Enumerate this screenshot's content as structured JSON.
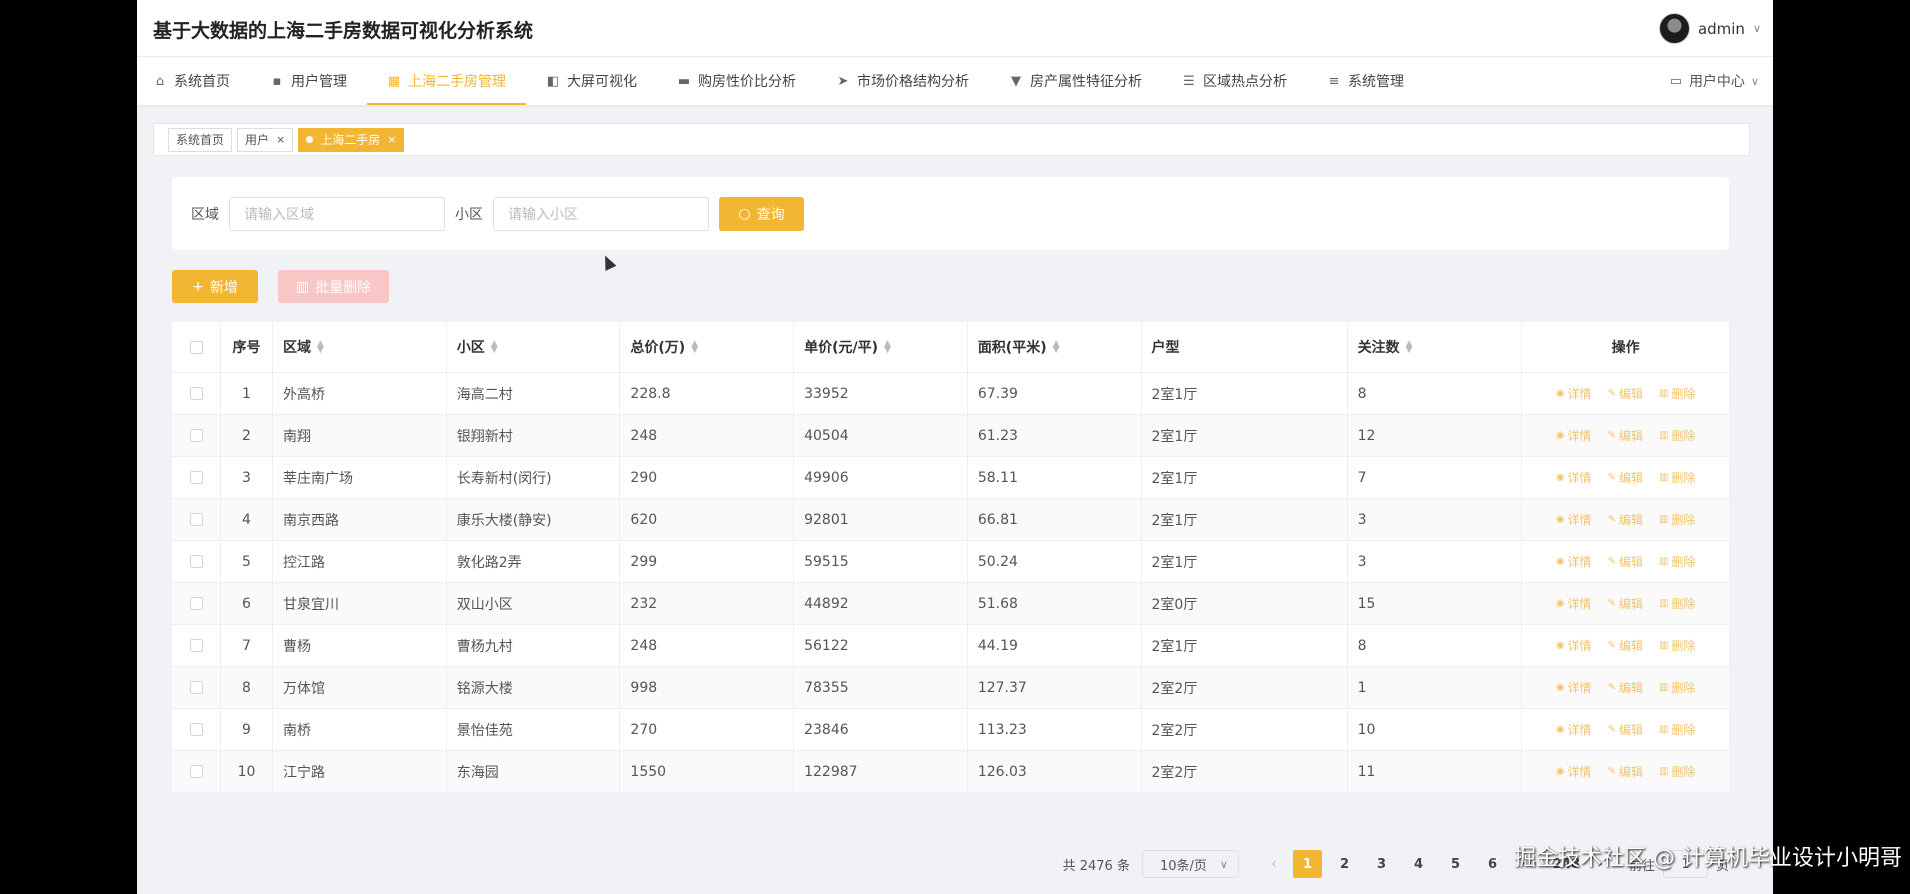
{
  "app": {
    "title": "基于大数据的上海二手房数据可视化分析系统",
    "username": "admin"
  },
  "menu": [
    {
      "label": "系统首页",
      "icon": "home-icon",
      "glyph": "⌂"
    },
    {
      "label": "用户管理",
      "icon": "chat-icon",
      "glyph": "▪"
    },
    {
      "label": "上海二手房管理",
      "icon": "grid-icon",
      "glyph": "▦"
    },
    {
      "label": "大屏可视化",
      "icon": "wallet-icon",
      "glyph": "◧"
    },
    {
      "label": "购房性价比分析",
      "icon": "briefcase-icon",
      "glyph": "▬"
    },
    {
      "label": "市场价格结构分析",
      "icon": "send-icon",
      "glyph": "➤"
    },
    {
      "label": "房产属性特征分析",
      "icon": "ice-cream-icon",
      "glyph": "▼"
    },
    {
      "label": "区域热点分析",
      "icon": "sliders-icon",
      "glyph": "☰"
    },
    {
      "label": "系统管理",
      "icon": "list-icon",
      "glyph": "≡"
    }
  ],
  "active_menu": "上海二手房管理",
  "user_center": "用户中心",
  "tags": [
    {
      "label": "系统首页"
    },
    {
      "label": "用户",
      "close": "×"
    },
    {
      "label": "上海二手房",
      "close": "×"
    }
  ],
  "search": {
    "region_label": "区域",
    "region_placeholder": "请输入区域",
    "community_label": "小区",
    "community_placeholder": "请输入小区",
    "query_button": "查询"
  },
  "actions": {
    "add": "新增",
    "batch_delete": "批量删除"
  },
  "table": {
    "headers": [
      "序号",
      "区域",
      "小区",
      "总价(万)",
      "单价(元/平)",
      "面积(平米)",
      "户型",
      "关注数",
      "操作"
    ],
    "row_actions": {
      "detail": "详情",
      "edit": "编辑",
      "delete": "删除"
    },
    "rows": [
      [
        "1",
        "外高桥",
        "海高二村",
        "228.8",
        "33952",
        "67.39",
        "2室1厅",
        "8"
      ],
      [
        "2",
        "南翔",
        "银翔新村",
        "248",
        "40504",
        "61.23",
        "2室1厅",
        "12"
      ],
      [
        "3",
        "莘庄南广场",
        "长寿新村(闵行)",
        "290",
        "49906",
        "58.11",
        "2室1厅",
        "7"
      ],
      [
        "4",
        "南京西路",
        "康乐大楼(静安)",
        "620",
        "92801",
        "66.81",
        "2室1厅",
        "3"
      ],
      [
        "5",
        "控江路",
        "敦化路2弄",
        "299",
        "59515",
        "50.24",
        "2室1厅",
        "3"
      ],
      [
        "6",
        "甘泉宜川",
        "双山小区",
        "232",
        "44892",
        "51.68",
        "2室0厅",
        "15"
      ],
      [
        "7",
        "曹杨",
        "曹杨九村",
        "248",
        "56122",
        "44.19",
        "2室1厅",
        "8"
      ],
      [
        "8",
        "万体馆",
        "铭源大楼",
        "998",
        "78355",
        "127.37",
        "2室2厅",
        "1"
      ],
      [
        "9",
        "南桥",
        "景怡佳苑",
        "270",
        "23846",
        "113.23",
        "2室2厅",
        "10"
      ],
      [
        "10",
        "江宁路",
        "东海园",
        "1550",
        "122987",
        "126.03",
        "2室2厅",
        "11"
      ]
    ]
  },
  "pagination": {
    "total": "共 2476 条",
    "page_size": "10条/页",
    "prev": "‹",
    "next": "›",
    "pages": [
      "1",
      "2",
      "3",
      "4",
      "5",
      "6",
      "···",
      "248"
    ],
    "current": "1",
    "goto_label": "前往",
    "goto_value": "1",
    "goto_suffix": "页"
  },
  "watermark": "掘金技术社区 @ 计算机毕业设计小明哥",
  "colors": {
    "accent": "#f3b633",
    "danger_light": "#f9c6c6"
  }
}
